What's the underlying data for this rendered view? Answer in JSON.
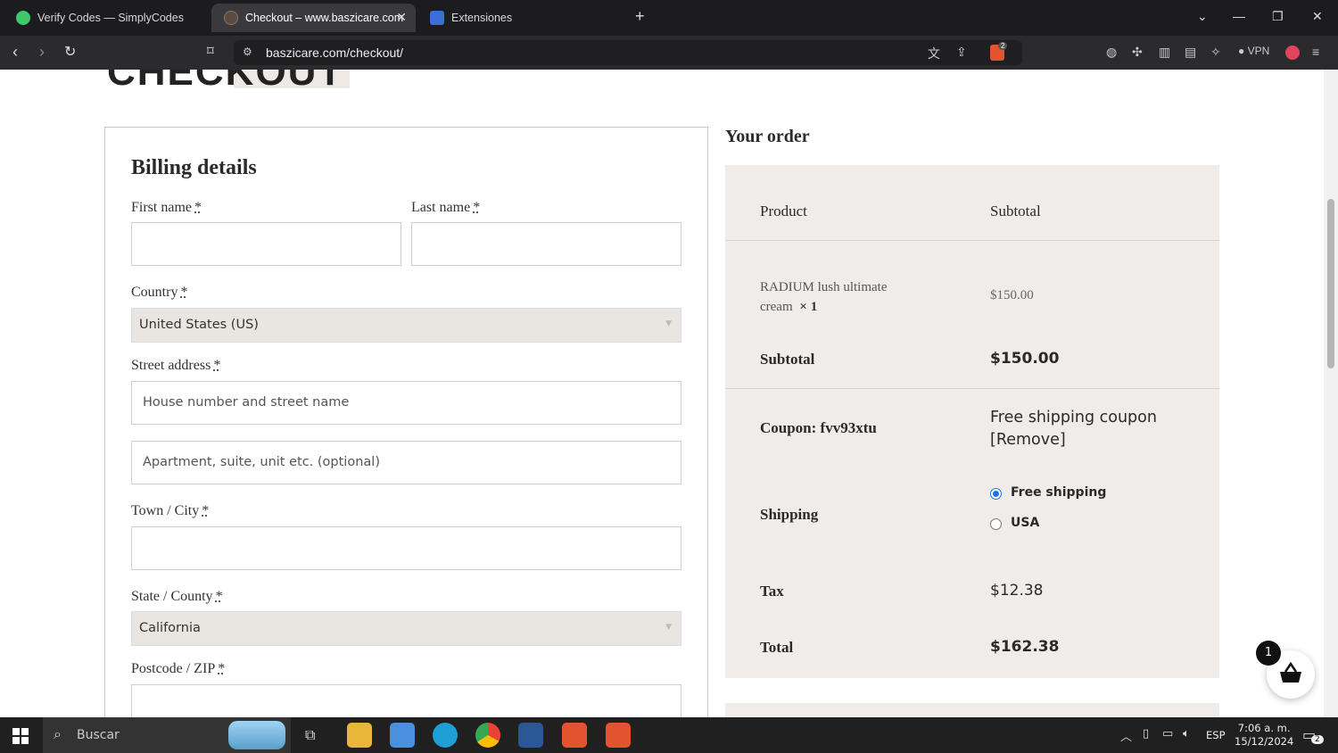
{
  "browser": {
    "tabs": [
      {
        "title": "Verify Codes — SimplyCodes",
        "icon": "simplycodes-icon",
        "color": "#3ec86a"
      },
      {
        "title": "Checkout – www.baszicare.com",
        "icon": "site-favicon",
        "color": "#5b4a3f"
      },
      {
        "title": "Extensiones",
        "icon": "puzzle-icon",
        "color": "#3b6fd8"
      }
    ],
    "url": "baszicare.com/checkout/",
    "vpn_label": "VPN",
    "shield_count": "2"
  },
  "page": {
    "logo_text": "CHECKOUT",
    "billing": {
      "heading": "Billing details",
      "required_mark": "*",
      "first_name_label": "First name",
      "last_name_label": "Last name",
      "country_label": "Country",
      "country_value": "United States (US)",
      "street_label": "Street address",
      "street_placeholder": "House number and street name",
      "apartment_placeholder": "Apartment, suite, unit etc. (optional)",
      "city_label": "Town / City",
      "state_label": "State / County",
      "state_value": "California",
      "postcode_label": "Postcode / ZIP"
    },
    "order": {
      "title": "Your order",
      "col_product": "Product",
      "col_subtotal": "Subtotal",
      "item_name_line1": "RADIUM lush ultimate",
      "item_name_line2": "cream",
      "item_qty": "× 1",
      "item_price": "$150.00",
      "subtotal_label": "Subtotal",
      "subtotal_value": "$150.00",
      "coupon_label": "Coupon: fvv93xtu",
      "coupon_value": "Free shipping coupon",
      "coupon_remove": "[Remove]",
      "shipping_label": "Shipping",
      "shipping_options": [
        {
          "label": "Free shipping",
          "selected": true
        },
        {
          "label": "USA",
          "selected": false
        }
      ],
      "tax_label": "Tax",
      "tax_value": "$12.38",
      "total_label": "Total",
      "total_value": "$162.38"
    },
    "cart_count": "1"
  },
  "taskbar": {
    "search_label": "Buscar",
    "language": "ESP",
    "time": "7:06 a. m.",
    "date": "15/12/2024",
    "notification_count": "2"
  }
}
